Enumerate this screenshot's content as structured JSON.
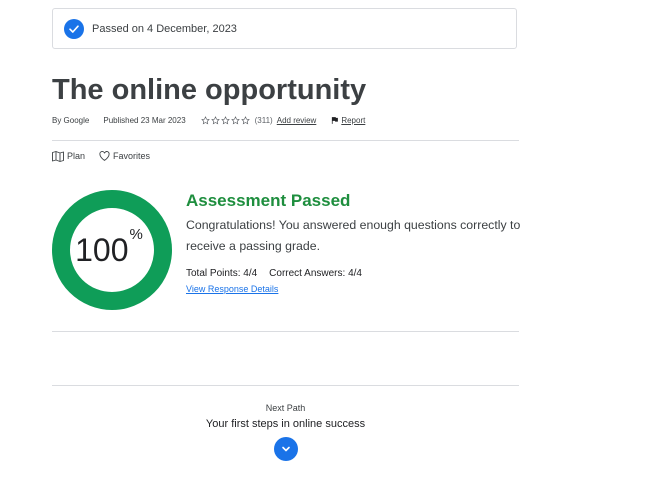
{
  "banner": {
    "text": "Passed on 4 December, 2023",
    "icon": "check-circle-icon"
  },
  "course": {
    "title": "The online opportunity",
    "author": "By Google",
    "published": "Published 23 Mar 2023",
    "rating_stars": 5,
    "rating_filled": 0,
    "rating_count": "(311)",
    "add_review": "Add review",
    "report": "Report"
  },
  "actions": {
    "plan": "Plan",
    "favorites": "Favorites"
  },
  "result": {
    "percent": 100,
    "percent_text": "100",
    "percent_sign": "%",
    "heading": "Assessment Passed",
    "message": "Congratulations! You answered enough questions correctly to receive a passing grade.",
    "total_points": "Total Points: 4/4",
    "correct_answers": "Correct Answers: 4/4",
    "details_link": "View Response Details"
  },
  "next": {
    "label": "Next Path",
    "course": "Your first steps in online success",
    "icon": "chevron-down-icon"
  },
  "colors": {
    "accent": "#1a73e8",
    "success": "#1e8e3e",
    "ring": "#0f9d58",
    "ring_track": "#e6f4ea"
  }
}
